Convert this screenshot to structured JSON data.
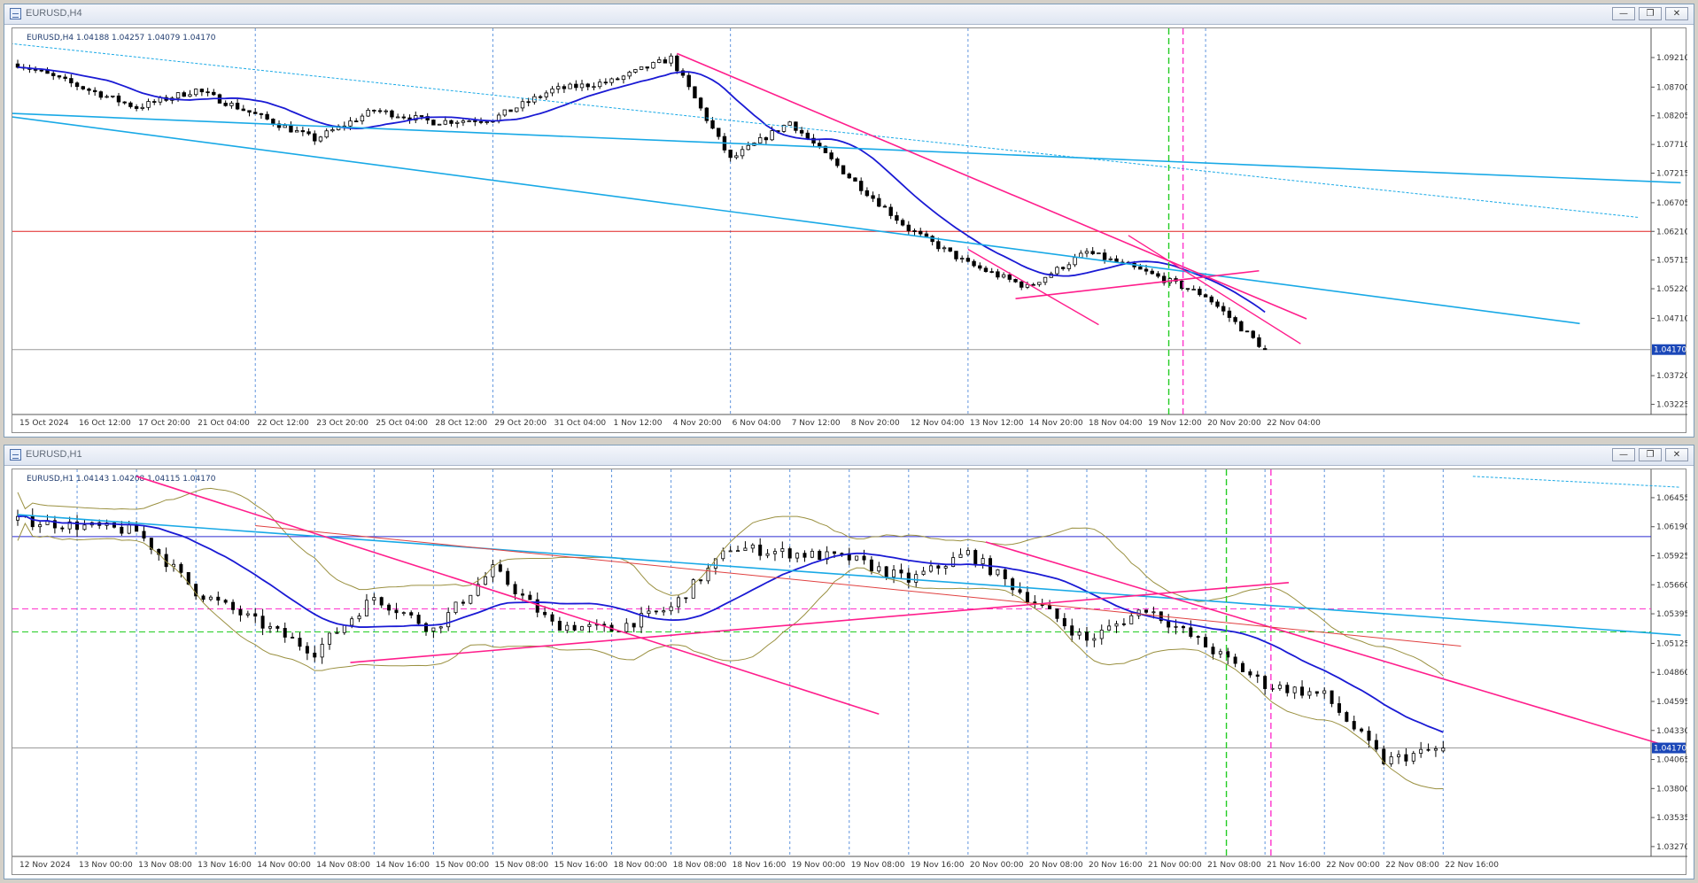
{
  "window_top": {
    "title": "EURUSD,H4",
    "header_line": "EURUSD,H4  1.04188 1.04257 1.04079 1.04170",
    "current_price": "1.04170",
    "price_ticks": [
      "1.09210",
      "1.08700",
      "1.08205",
      "1.07710",
      "1.07215",
      "1.06705",
      "1.06210",
      "1.05715",
      "1.05220",
      "1.04710",
      "1.04170",
      "1.03720",
      "1.03225"
    ],
    "time_ticks": [
      "15 Oct 2024",
      "16 Oct 12:00",
      "17 Oct 20:00",
      "21 Oct 04:00",
      "22 Oct 12:00",
      "23 Oct 20:00",
      "25 Oct 04:00",
      "28 Oct 12:00",
      "29 Oct 20:00",
      "31 Oct 04:00",
      "1 Nov 12:00",
      "4 Nov 20:00",
      "6 Nov 04:00",
      "7 Nov 12:00",
      "8 Nov 20:00",
      "12 Nov 04:00",
      "13 Nov 12:00",
      "14 Nov 20:00",
      "18 Nov 04:00",
      "19 Nov 12:00",
      "20 Nov 20:00",
      "22 Nov 04:00"
    ],
    "buttons": {
      "minimize": "—",
      "restore": "❐",
      "close": "✕"
    }
  },
  "window_bottom": {
    "title": "EURUSD,H1",
    "header_line": "EURUSD,H1  1.04143 1.04208 1.04115 1.04170",
    "current_price": "1.04170",
    "price_ticks": [
      "1.06455",
      "1.06190",
      "1.05925",
      "1.05660",
      "1.05395",
      "1.05125",
      "1.04860",
      "1.04595",
      "1.04330",
      "1.04170",
      "1.04065",
      "1.03800",
      "1.03535",
      "1.03270"
    ],
    "time_ticks": [
      "12 Nov 2024",
      "13 Nov 00:00",
      "13 Nov 08:00",
      "13 Nov 16:00",
      "14 Nov 00:00",
      "14 Nov 08:00",
      "14 Nov 16:00",
      "15 Nov 00:00",
      "15 Nov 08:00",
      "15 Nov 16:00",
      "18 Nov 00:00",
      "18 Nov 08:00",
      "18 Nov 16:00",
      "19 Nov 00:00",
      "19 Nov 08:00",
      "19 Nov 16:00",
      "20 Nov 00:00",
      "20 Nov 08:00",
      "20 Nov 16:00",
      "21 Nov 00:00",
      "21 Nov 08:00",
      "21 Nov 16:00",
      "22 Nov 00:00",
      "22 Nov 08:00",
      "22 Nov 16:00"
    ],
    "buttons": {
      "minimize": "—",
      "restore": "❐",
      "close": "✕"
    }
  },
  "colors": {
    "channel": "#19a9e6",
    "trend_pink": "#ff1e8c",
    "ma_blue": "#1a1ad4",
    "hline_red": "#e02020",
    "hline_blue": "#2b2bd0",
    "bollinger": "#9a9040",
    "grid_dash": "#3a7bd5",
    "vline_green": "#22cc22",
    "vline_magenta": "#ff33cc",
    "price_box": "#1a47b8"
  },
  "chart_data": [
    {
      "type": "candlestick",
      "title": "EURUSD,H4",
      "ylim": [
        1.0305,
        1.095
      ],
      "last_ohlc": {
        "open": 1.04188,
        "high": 1.04257,
        "low": 1.04079,
        "close": 1.0417
      },
      "close_path": [
        {
          "x": "15 Oct 2024",
          "y": 1.091
        },
        {
          "x": "17 Oct 20:00",
          "y": 1.0835
        },
        {
          "x": "21 Oct 04:00",
          "y": 1.0865
        },
        {
          "x": "23 Oct 20:00",
          "y": 1.078
        },
        {
          "x": "25 Oct 04:00",
          "y": 1.083
        },
        {
          "x": "28 Oct 12:00",
          "y": 1.081
        },
        {
          "x": "29 Oct 20:00",
          "y": 1.0815
        },
        {
          "x": "31 Oct 04:00",
          "y": 1.0865
        },
        {
          "x": "1 Nov 12:00",
          "y": 1.088
        },
        {
          "x": "4 Nov 20:00",
          "y": 1.092
        },
        {
          "x": "6 Nov 04:00",
          "y": 1.0745
        },
        {
          "x": "7 Nov 12:00",
          "y": 1.081
        },
        {
          "x": "8 Nov 20:00",
          "y": 1.0715
        },
        {
          "x": "12 Nov 04:00",
          "y": 1.0625
        },
        {
          "x": "13 Nov 12:00",
          "y": 1.0565
        },
        {
          "x": "14 Nov 20:00",
          "y": 1.0525
        },
        {
          "x": "18 Nov 04:00",
          "y": 1.0585
        },
        {
          "x": "19 Nov 12:00",
          "y": 1.055
        },
        {
          "x": "20 Nov 20:00",
          "y": 1.051
        },
        {
          "x": "22 Nov 04:00",
          "y": 1.0417
        }
      ],
      "horizontal_levels": [
        1.0621,
        1.0417
      ],
      "legend": "none",
      "grid": "vertical dashed"
    },
    {
      "type": "candlestick",
      "title": "EURUSD,H1",
      "ylim": [
        1.0318,
        1.066
      ],
      "last_ohlc": {
        "open": 1.04143,
        "high": 1.04208,
        "low": 1.04115,
        "close": 1.0417
      },
      "close_path": [
        {
          "x": "12 Nov 2024",
          "y": 1.0625
        },
        {
          "x": "13 Nov 08:00",
          "y": 1.0615
        },
        {
          "x": "13 Nov 16:00",
          "y": 1.056
        },
        {
          "x": "14 Nov 08:00",
          "y": 1.0505
        },
        {
          "x": "14 Nov 16:00",
          "y": 1.0555
        },
        {
          "x": "15 Nov 00:00",
          "y": 1.0525
        },
        {
          "x": "15 Nov 08:00",
          "y": 1.058
        },
        {
          "x": "15 Nov 16:00",
          "y": 1.053
        },
        {
          "x": "18 Nov 00:00",
          "y": 1.0525
        },
        {
          "x": "18 Nov 08:00",
          "y": 1.0545
        },
        {
          "x": "18 Nov 16:00",
          "y": 1.06
        },
        {
          "x": "19 Nov 08:00",
          "y": 1.059
        },
        {
          "x": "19 Nov 16:00",
          "y": 1.057
        },
        {
          "x": "20 Nov 00:00",
          "y": 1.0595
        },
        {
          "x": "20 Nov 16:00",
          "y": 1.0515
        },
        {
          "x": "21 Nov 00:00",
          "y": 1.0545
        },
        {
          "x": "21 Nov 08:00",
          "y": 1.051
        },
        {
          "x": "21 Nov 16:00",
          "y": 1.0475
        },
        {
          "x": "22 Nov 00:00",
          "y": 1.0465
        },
        {
          "x": "22 Nov 08:00",
          "y": 1.0405
        },
        {
          "x": "22 Nov 16:00",
          "y": 1.0417
        }
      ],
      "horizontal_levels": [
        1.061,
        1.0544,
        1.0523,
        1.0417
      ],
      "legend": "none",
      "grid": "vertical dashed"
    }
  ]
}
